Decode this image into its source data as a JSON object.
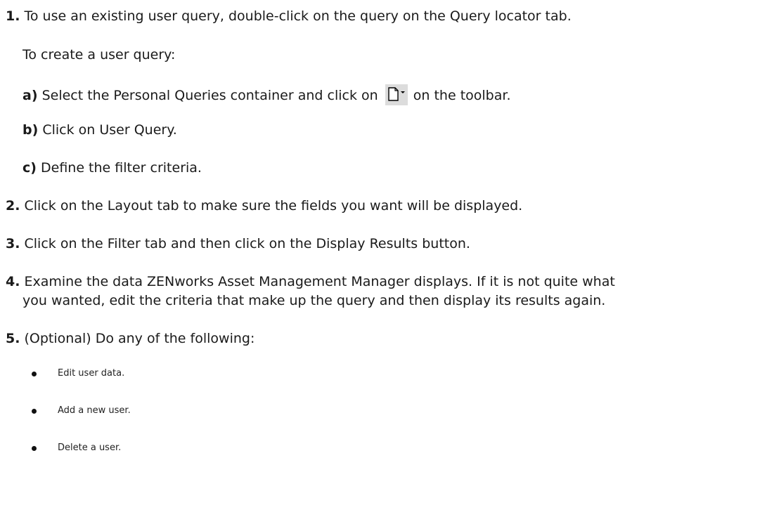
{
  "steps": [
    {
      "num": "1.",
      "text": "To use an existing user query, double-click on the query on the Query locator tab."
    },
    {
      "num": "2.",
      "text": "Click on the Layout tab to make sure the fields you want will be displayed."
    },
    {
      "num": "3.",
      "text": "Click on the Filter tab and then click on the Display Results button."
    },
    {
      "num": "4.",
      "text": "Examine the data ZENworks Asset Management Manager displays. If it is not quite what",
      "text_cont": "you wanted, edit the criteria that make up the query and then display its results again."
    },
    {
      "num": "5.",
      "text": "(Optional) Do any of the following:"
    }
  ],
  "create_intro": "To create a user query:",
  "substeps": [
    {
      "letter": "a)",
      "text_before": "Select the Personal Queries container and click on",
      "text_after": "on the toolbar."
    },
    {
      "letter": "b)",
      "text": "Click on User Query."
    },
    {
      "letter": "c)",
      "text": "Define the filter criteria."
    }
  ],
  "icons": {
    "new_query": "new-document-dropdown-icon"
  },
  "colors": {
    "text": "#1a1a1a",
    "icon_bg": "#dcdcdc"
  },
  "bullets": [
    "Edit user data.",
    "Add a new user.",
    "Delete a user."
  ]
}
